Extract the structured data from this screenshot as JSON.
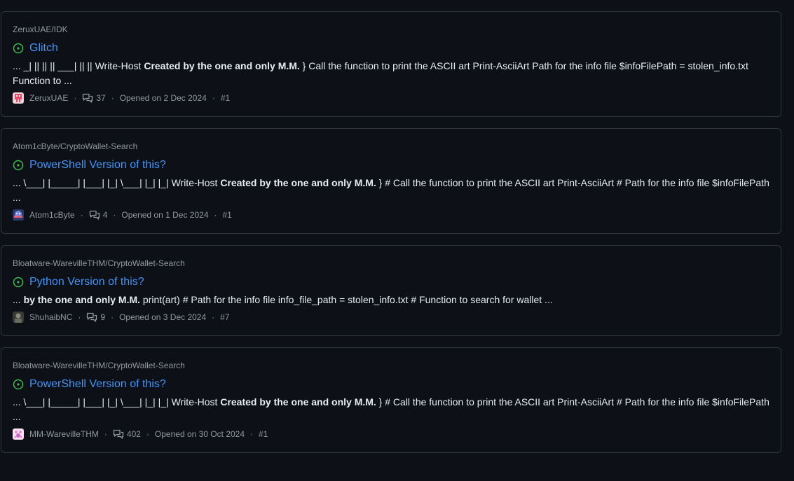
{
  "results": [
    {
      "repo": "ZeruxUAE/IDK",
      "title": "Glitch",
      "snippet_pre": "... _| || || || ___| || || Write-Host ",
      "snippet_bold": "Created by the one and only M.M.",
      "snippet_post": " } Call the function to print the ASCII art Print-AsciiArt Path for the info file $infoFilePath = stolen_info.txt Function to ...",
      "author": "ZeruxUAE",
      "comments": "37",
      "opened": "Opened on 2 Dec 2024",
      "number": "#1",
      "avatar_color": "#e84a6a"
    },
    {
      "repo": "Atom1cByte/CryptoWallet-Search",
      "title": "PowerShell Version of this?",
      "snippet_pre": "... \\___| |_____| |___| |_| \\___| |_| |_| Write-Host ",
      "snippet_bold": "Created by the one and only M.M.",
      "snippet_post": " } # Call the function to print the ASCII art Print-AsciiArt # Path for the info file $infoFilePath ...",
      "author": "Atom1cByte",
      "comments": "4",
      "opened": "Opened on 1 Dec 2024",
      "number": "#1",
      "avatar_color": "#5b6cc4"
    },
    {
      "repo": "Bloatware-WarevilleTHM/CryptoWallet-Search",
      "title": "Python Version of this?",
      "snippet_pre": "... ",
      "snippet_bold": "by the one and only M.M.",
      "snippet_post": " print(art) # Path for the info file info_file_path = stolen_info.txt # Function to search for wallet ...",
      "author": "ShuhaibNC",
      "comments": "9",
      "opened": "Opened on 3 Dec 2024",
      "number": "#7",
      "avatar_color": "#5a5a4e"
    },
    {
      "repo": "Bloatware-WarevilleTHM/CryptoWallet-Search",
      "title": "PowerShell Version of this?",
      "snippet_pre": "... \\___| |_____| |___| |_| \\___| |_| |_| Write-Host ",
      "snippet_bold": "Created by the one and only M.M.",
      "snippet_post": " } # Call the function to print the ASCII art Print-AsciiArt # Path for the info file $infoFilePath ...",
      "author": "MM-WarevilleTHM",
      "comments": "402",
      "opened": "Opened on 30 Oct 2024",
      "number": "#1",
      "avatar_color": "#e88ad8"
    }
  ],
  "colors": {
    "background": "#0d1117",
    "border": "#30363d",
    "link": "#4493f8",
    "open_icon": "#3fb950",
    "muted": "#9198a1"
  },
  "icons": {
    "open": "issue-opened-icon",
    "comment": "comment-discussion-icon"
  }
}
